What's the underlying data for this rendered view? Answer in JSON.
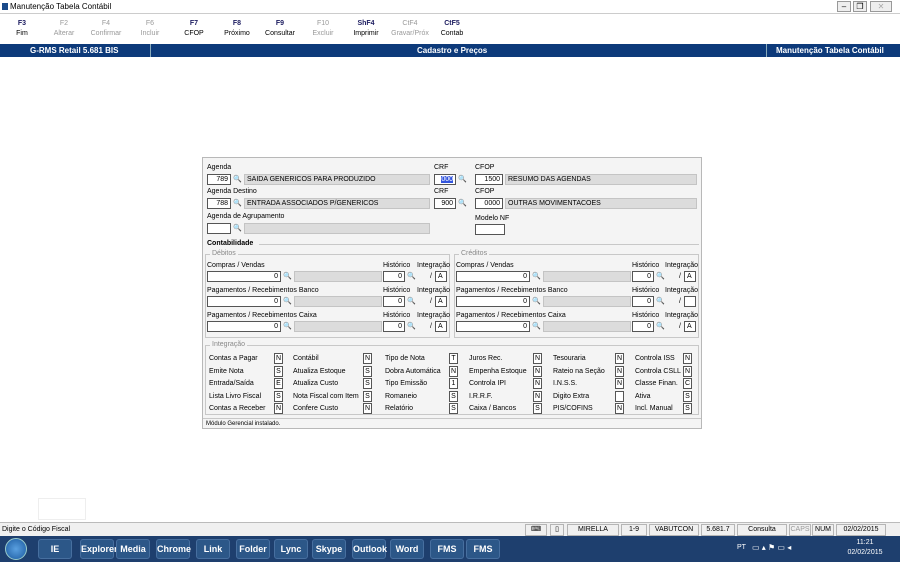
{
  "window": {
    "title": "Manutenção Tabela Contábil"
  },
  "toolbar": [
    {
      "key": "F3",
      "label": "Fim",
      "disabled": false
    },
    {
      "key": "F2",
      "label": "Alterar",
      "disabled": true
    },
    {
      "key": "F4",
      "label": "Confirmar",
      "disabled": true
    },
    {
      "key": "F6",
      "label": "Incluir",
      "disabled": true
    },
    {
      "key": "F7",
      "label": "CFOP",
      "disabled": false
    },
    {
      "key": "F8",
      "label": "Próximo",
      "disabled": false
    },
    {
      "key": "F9",
      "label": "Consultar",
      "disabled": false
    },
    {
      "key": "F10",
      "label": "Excluir",
      "disabled": true
    },
    {
      "key": "ShF4",
      "label": "Imprimir",
      "disabled": false
    },
    {
      "key": "CtF4",
      "label": "Gravar/Próx",
      "disabled": true
    },
    {
      "key": "CtF5",
      "label": "Contab",
      "disabled": false
    }
  ],
  "header": {
    "app": "G-RMS Retail 5.681 BIS",
    "section": "Cadastro e Preços",
    "screen": "Manutenção Tabela Contábil"
  },
  "form": {
    "agenda_label": "Agenda",
    "agenda_code": "789",
    "agenda_desc": "SAIDA GENERICOS PARA PRODUZIDO",
    "crf_label": "CRF",
    "crf1": "000",
    "crf2": "900",
    "cfop_label": "CFOP",
    "cfop1_code": "1500",
    "cfop1_desc": "RESUMO DAS AGENDAS",
    "destino_label": "Agenda Destino",
    "destino_code": "788",
    "destino_desc": "ENTRADA ASSOCIADOS P/GENERICOS",
    "cfop2_code": "0000",
    "cfop2_desc": "OUTRAS MOVIMENTACOES",
    "agrup_label": "Agenda de Agrupamento",
    "agrup_code": "",
    "agrup_desc": "",
    "modelo_label": "Modelo NF",
    "modelo_value": ""
  },
  "contab": {
    "title": "Contabilidade",
    "debitos": "Débitos",
    "creditos": "Créditos",
    "historico": "Histórico",
    "integracao": "Integração",
    "rows": [
      {
        "label": "Compras / Vendas",
        "deb_val": "0",
        "deb_hist": "0",
        "deb_int": "A",
        "cred_val": "0",
        "cred_hist": "0",
        "cred_int": "A"
      },
      {
        "label": "Pagamentos / Recebimentos Banco",
        "deb_val": "0",
        "deb_hist": "0",
        "deb_int": "A",
        "cred_val": "0",
        "cred_hist": "0",
        "cred_int": ""
      },
      {
        "label": "Pagamentos / Recebimentos Caixa",
        "deb_val": "0",
        "deb_hist": "0",
        "deb_int": "A",
        "cred_val": "0",
        "cred_hist": "0",
        "cred_int": "A"
      }
    ]
  },
  "integracao": {
    "title": "Integração",
    "cols": [
      [
        {
          "l": "Contas a Pagar",
          "v": "N"
        },
        {
          "l": "Emite Nota",
          "v": "S"
        },
        {
          "l": "Entrada/Saída",
          "v": "E"
        },
        {
          "l": "Lista Livro Fiscal",
          "v": "S"
        },
        {
          "l": "Contas a Receber",
          "v": "N"
        }
      ],
      [
        {
          "l": "Contábil",
          "v": "N"
        },
        {
          "l": "Atualiza Estoque",
          "v": "S"
        },
        {
          "l": "Atualiza Custo",
          "v": "S"
        },
        {
          "l": "Nota Fiscal com Item",
          "v": "S"
        },
        {
          "l": "Confere Custo",
          "v": "N"
        }
      ],
      [
        {
          "l": "Tipo de Nota",
          "v": "T"
        },
        {
          "l": "Dobra Automática",
          "v": "N"
        },
        {
          "l": "Tipo Emissão",
          "v": "1"
        },
        {
          "l": "Romaneio",
          "v": "S"
        },
        {
          "l": "Relatório",
          "v": "S"
        }
      ],
      [
        {
          "l": "Juros Rec.",
          "v": "N"
        },
        {
          "l": "Empenha Estoque",
          "v": "N"
        },
        {
          "l": "Controla IPI",
          "v": "N"
        },
        {
          "l": "I.R.R.F.",
          "v": "N"
        },
        {
          "l": "Caixa / Bancos",
          "v": "S"
        }
      ],
      [
        {
          "l": "Tesouraria",
          "v": "N"
        },
        {
          "l": "Rateio na Seção",
          "v": "N"
        },
        {
          "l": "I.N.S.S.",
          "v": "N"
        },
        {
          "l": "Digito Extra",
          "v": ""
        },
        {
          "l": "PIS/COFINS",
          "v": "N"
        }
      ],
      [
        {
          "l": "Controla ISS",
          "v": "N"
        },
        {
          "l": "Controla CSLL",
          "v": "N"
        },
        {
          "l": "Classe Finan.",
          "v": "C"
        },
        {
          "l": "Ativa",
          "v": "S"
        },
        {
          "l": "Incl. Manual",
          "v": "S"
        }
      ]
    ]
  },
  "message": "Módulo Gerencial instalado.",
  "status": {
    "hint": "Digite o Código Fiscal",
    "user": "MIRELLA",
    "range": "1-9",
    "host": "VABUTCON",
    "version": "5.681.7",
    "mode": "Consulta",
    "caps": "CAPS",
    "num": "NUM",
    "date": "02/02/2015"
  },
  "taskbar": {
    "lang": "PT",
    "time": "11:21",
    "date": "02/02/2015",
    "apps": [
      "IE",
      "Explorer",
      "Media",
      "Chrome",
      "Link",
      "Folder",
      "Lync",
      "Skype",
      "Outlook",
      "Word",
      "FMS",
      "FMS"
    ]
  }
}
